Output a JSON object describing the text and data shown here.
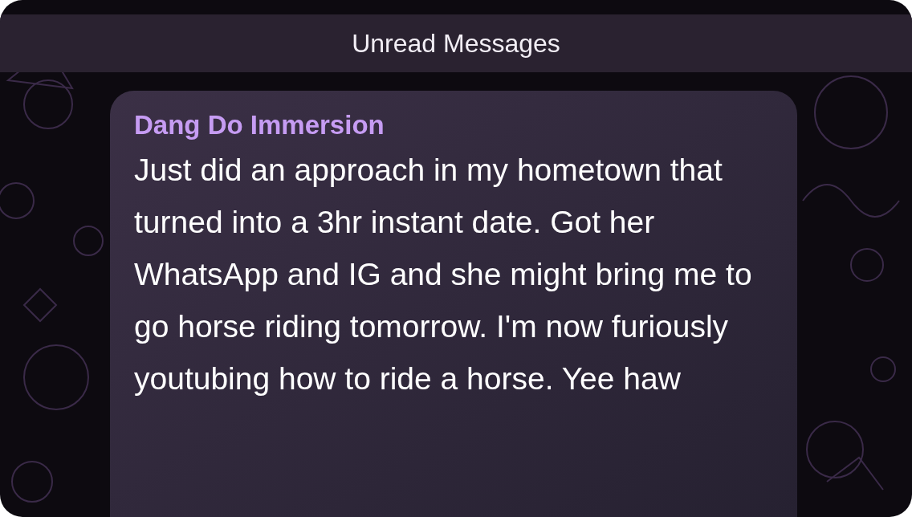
{
  "banner": {
    "title": "Unread Messages"
  },
  "message": {
    "sender": "Dang Do Immersion",
    "text": "Just did an approach in my hometown that turned into a 3hr instant date. Got her WhatsApp and IG and she might bring me to go horse riding tomorrow. I'm now furiously youtubing how to ride a horse. Yee haw"
  }
}
